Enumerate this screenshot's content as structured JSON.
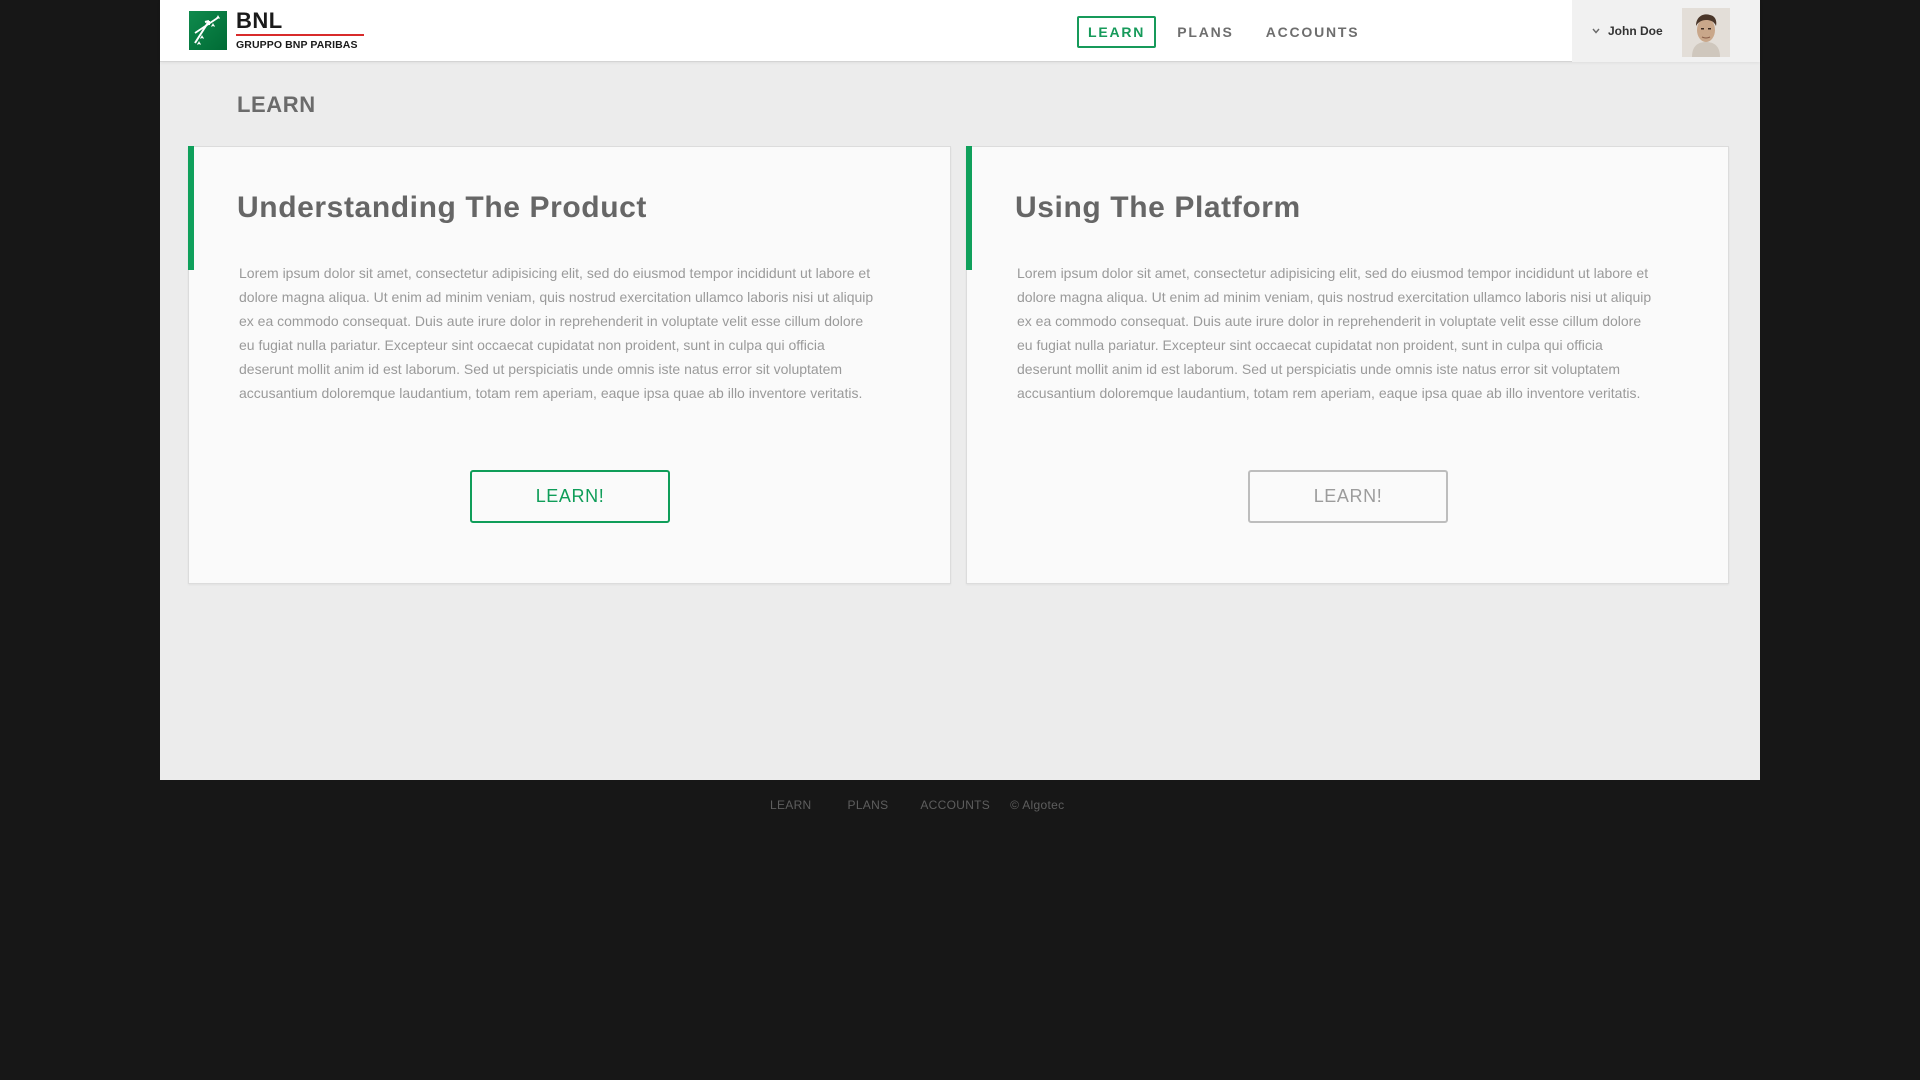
{
  "logo": {
    "name": "BNL",
    "subtitle": "GRUPPO BNP PARIBAS"
  },
  "nav": {
    "items": [
      {
        "label": "LEARN",
        "active": true
      },
      {
        "label": "PLANS",
        "active": false
      },
      {
        "label": "ACCOUNTS",
        "active": false
      }
    ]
  },
  "user": {
    "name": "John Doe",
    "menu_icon": "chevron-down-icon"
  },
  "page": {
    "title": "LEARN"
  },
  "cards": [
    {
      "title": "Understanding The Product",
      "body": "Lorem ipsum dolor sit amet, consectetur adipisicing elit, sed do eiusmod tempor incididunt ut labore et dolore magna aliqua. Ut enim ad minim veniam, quis nostrud exercitation ullamco laboris nisi ut aliquip ex ea commodo consequat. Duis aute irure dolor in reprehenderit in voluptate velit esse cillum dolore eu fugiat nulla pariatur. Excepteur sint occaecat cupidatat non proident, sunt in culpa qui officia deserunt mollit anim id est laborum. Sed ut perspiciatis unde omnis iste natus error sit voluptatem accusantium doloremque laudantium, totam rem aperiam, eaque ipsa quae ab illo inventore veritatis.",
      "button": "LEARN!"
    },
    {
      "title": "Using The Platform",
      "body": "Lorem ipsum dolor sit amet, consectetur adipisicing elit, sed do eiusmod tempor incididunt ut labore et dolore magna aliqua. Ut enim ad minim veniam, quis nostrud exercitation ullamco laboris nisi ut aliquip ex ea commodo consequat. Duis aute irure dolor in reprehenderit in voluptate velit esse cillum dolore eu fugiat nulla pariatur. Excepteur sint occaecat cupidatat non proident, sunt in culpa qui officia deserunt mollit anim id est laborum. Sed ut perspiciatis unde omnis iste natus error sit voluptatem accusantium doloremque laudantium, totam rem aperiam, eaque ipsa quae ab illo inventore veritatis.",
      "button": "LEARN!"
    }
  ],
  "footer": {
    "links": [
      "LEARN",
      "PLANS",
      "ACCOUNTS"
    ],
    "copyright": "© Algotec"
  },
  "colors": {
    "accent": "#0f9d59",
    "brand_red": "#d82b2b",
    "background": "#171717",
    "panel": "#ececec"
  }
}
